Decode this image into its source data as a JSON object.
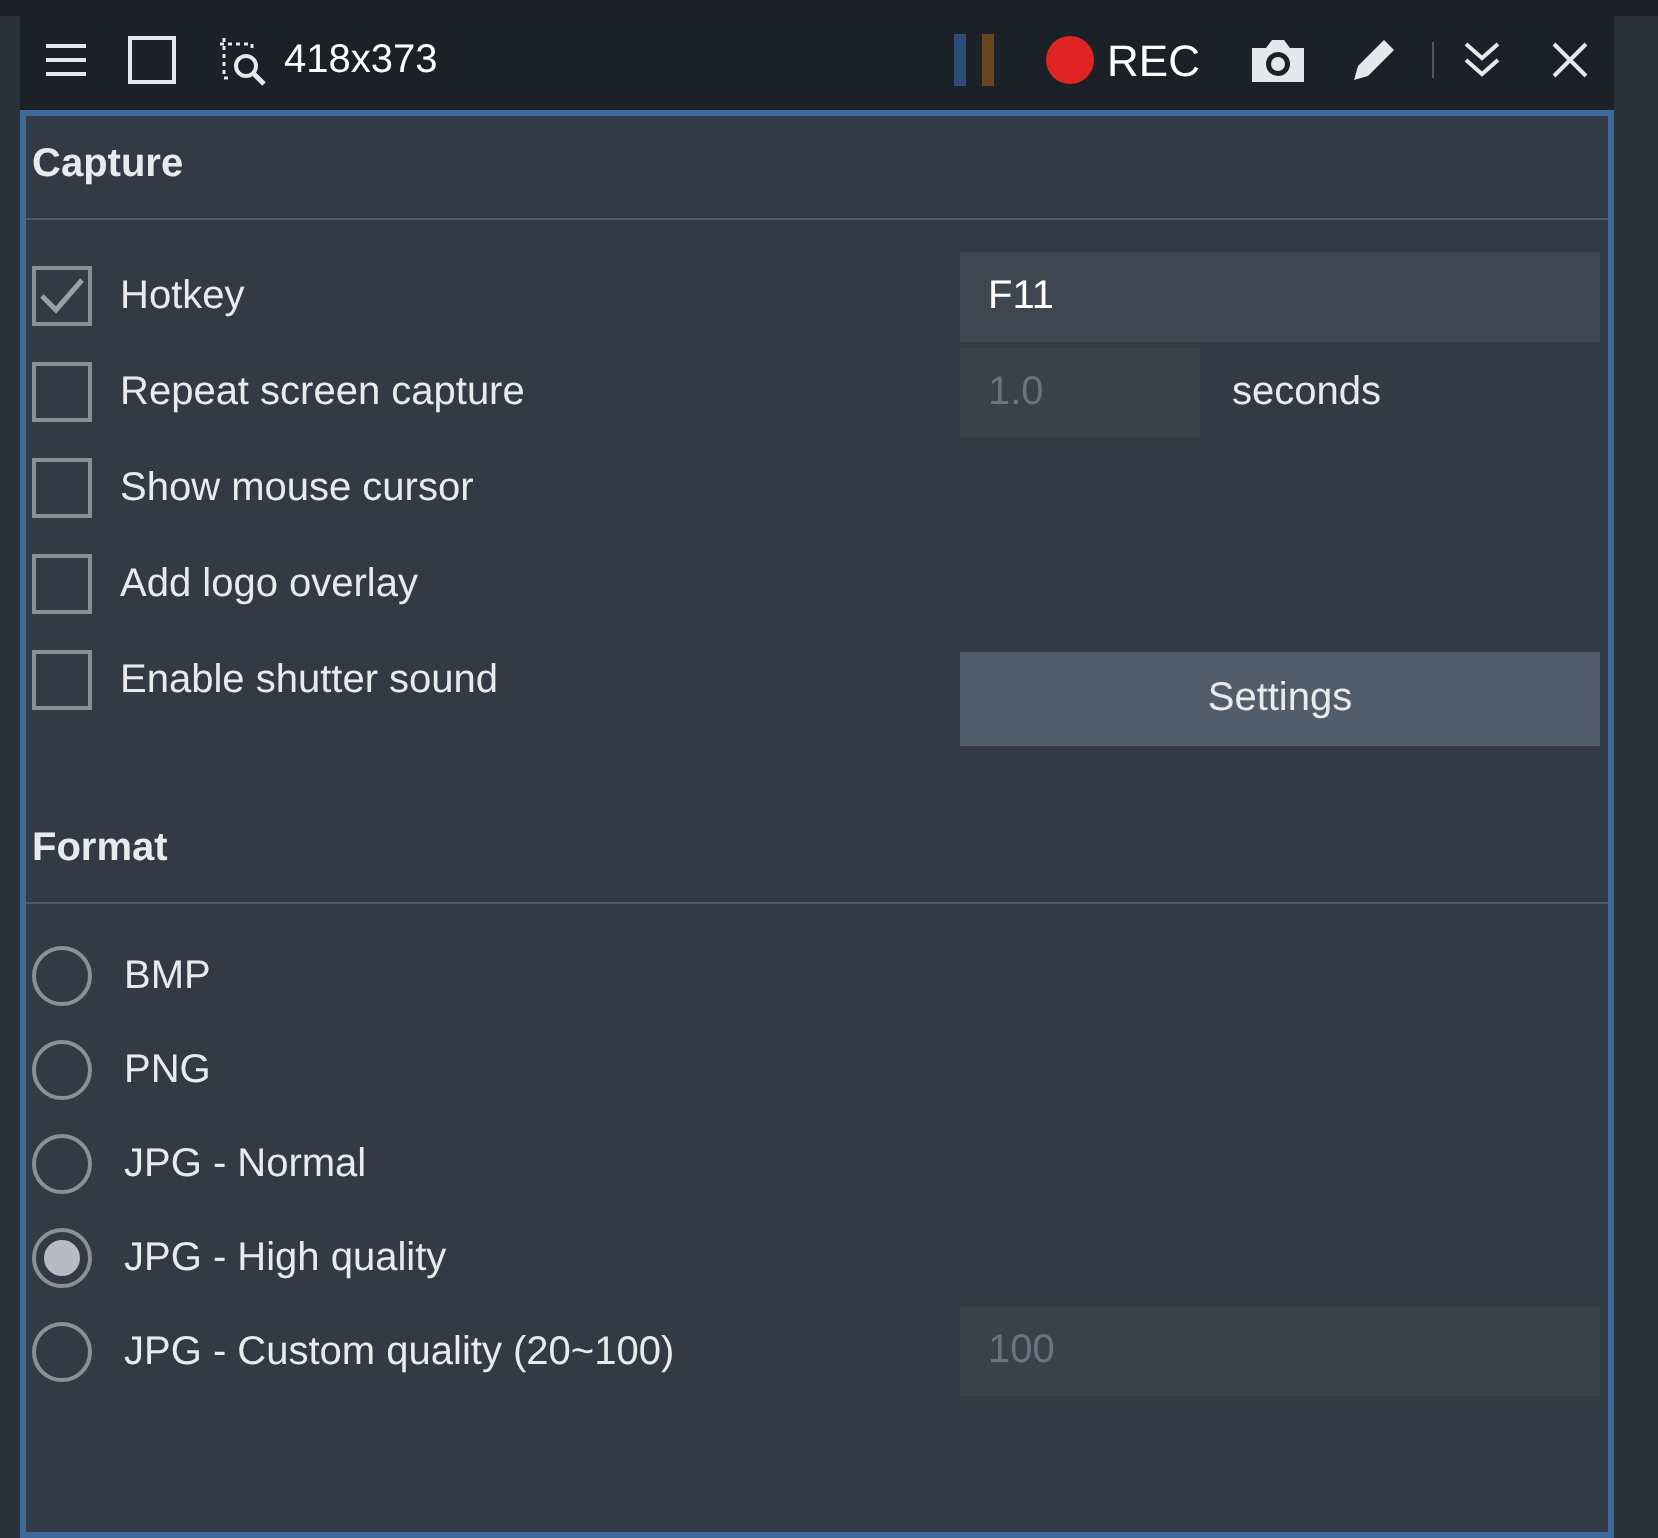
{
  "toolbar": {
    "size_label": "418x373",
    "rec_label": "REC"
  },
  "capture": {
    "title": "Capture",
    "options": [
      {
        "label": "Hotkey",
        "checked": true,
        "control": {
          "kind": "field",
          "value": "F11",
          "disabled": false
        }
      },
      {
        "label": "Repeat screen capture",
        "checked": false,
        "control": {
          "kind": "field_unit",
          "value": "1.0",
          "disabled": true,
          "unit": "seconds"
        }
      },
      {
        "label": "Show mouse cursor",
        "checked": false
      },
      {
        "label": "Add logo overlay",
        "checked": false
      },
      {
        "label": "Enable shutter sound",
        "checked": false,
        "control": {
          "kind": "button",
          "label": "Settings"
        }
      }
    ]
  },
  "format": {
    "title": "Format",
    "options": [
      {
        "label": "BMP",
        "selected": false
      },
      {
        "label": "PNG",
        "selected": false
      },
      {
        "label": "JPG - Normal",
        "selected": false
      },
      {
        "label": "JPG - High quality",
        "selected": true
      },
      {
        "label": "JPG - Custom quality (20~100)",
        "selected": false,
        "control": {
          "kind": "field",
          "value": "100",
          "disabled": true
        }
      }
    ]
  }
}
